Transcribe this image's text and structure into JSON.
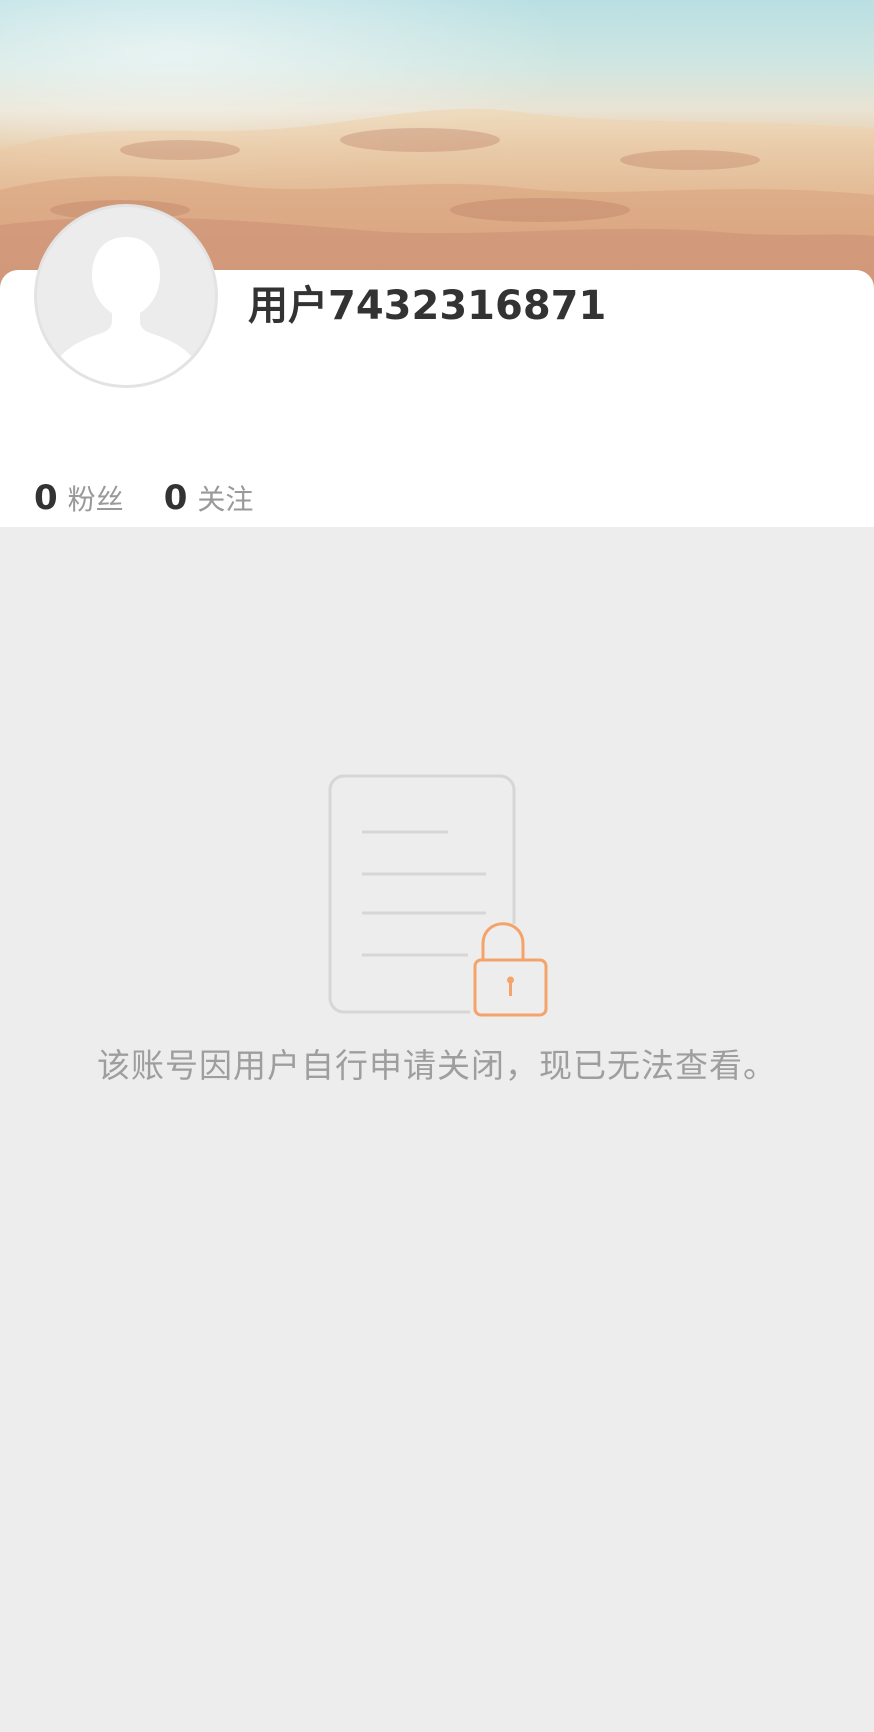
{
  "profile": {
    "username": "用户7432316871",
    "stats": [
      {
        "value": "0",
        "label": "粉丝"
      },
      {
        "value": "0",
        "label": "关注"
      }
    ]
  },
  "status": {
    "message": "该账号因用户自行申请关闭，现已无法查看。"
  },
  "icons": {
    "avatar": "default-user-silhouette-icon",
    "locked": "locked-document-icon"
  },
  "colors": {
    "page_background": "#ededed",
    "card_background": "#ffffff",
    "username_text": "#333333",
    "secondary_text": "#999999",
    "lock_accent": "#f4a46a"
  }
}
